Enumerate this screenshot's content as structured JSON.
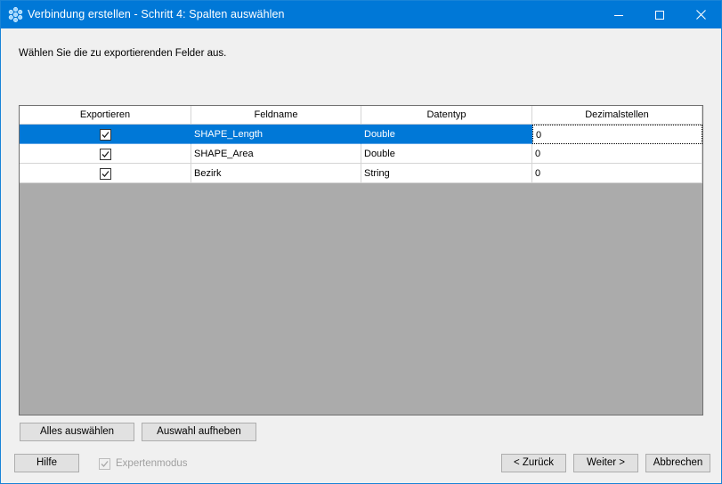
{
  "window": {
    "title": "Verbindung erstellen - Schritt 4: Spalten auswählen",
    "minimize_icon": "minimize-icon",
    "maximize_icon": "maximize-icon",
    "close_icon": "close-icon",
    "titlebar_color": "#0078d7"
  },
  "instruction": "Wählen Sie die zu exportierenden Felder aus.",
  "grid": {
    "columns": [
      "Exportieren",
      "Feldname",
      "Datentyp",
      "Dezimalstellen"
    ],
    "rows": [
      {
        "export": true,
        "name": "SHAPE_Length",
        "type": "Double",
        "decimals": "0",
        "selected": true
      },
      {
        "export": true,
        "name": "SHAPE_Area",
        "type": "Double",
        "decimals": "0",
        "selected": false
      },
      {
        "export": true,
        "name": "Bezirk",
        "type": "String",
        "decimals": "0",
        "selected": false
      }
    ],
    "selection_color": "#0078d7"
  },
  "buttons": {
    "select_all": "Alles auswählen",
    "clear_selection": "Auswahl aufheben",
    "help": "Hilfe",
    "back": "< Zurück",
    "next": "Weiter >",
    "cancel": "Abbrechen"
  },
  "expert_mode": {
    "label": "Expertenmodus",
    "checked": true,
    "enabled": false
  }
}
